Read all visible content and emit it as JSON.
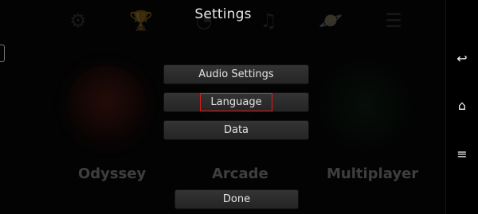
{
  "dialog": {
    "title": "Settings",
    "buttons": {
      "audio": "Audio Settings",
      "language": "Language",
      "data": "Data",
      "done": "Done"
    }
  },
  "background": {
    "modes": {
      "odyssey": "Odyssey",
      "arcade": "Arcade",
      "multiplayer": "Multiplayer"
    },
    "top_icons": [
      "gear-icon",
      "trophy-icon",
      "help-icon",
      "music-icon",
      "planet-icon",
      "list-icon"
    ]
  },
  "navigation": {
    "icons": [
      "back-icon",
      "home-icon",
      "menu-icon"
    ]
  },
  "colors": {
    "background": "#000000",
    "button": "#2c2c2c",
    "highlight": "#e31c1c",
    "text": "#e3e3e3"
  }
}
